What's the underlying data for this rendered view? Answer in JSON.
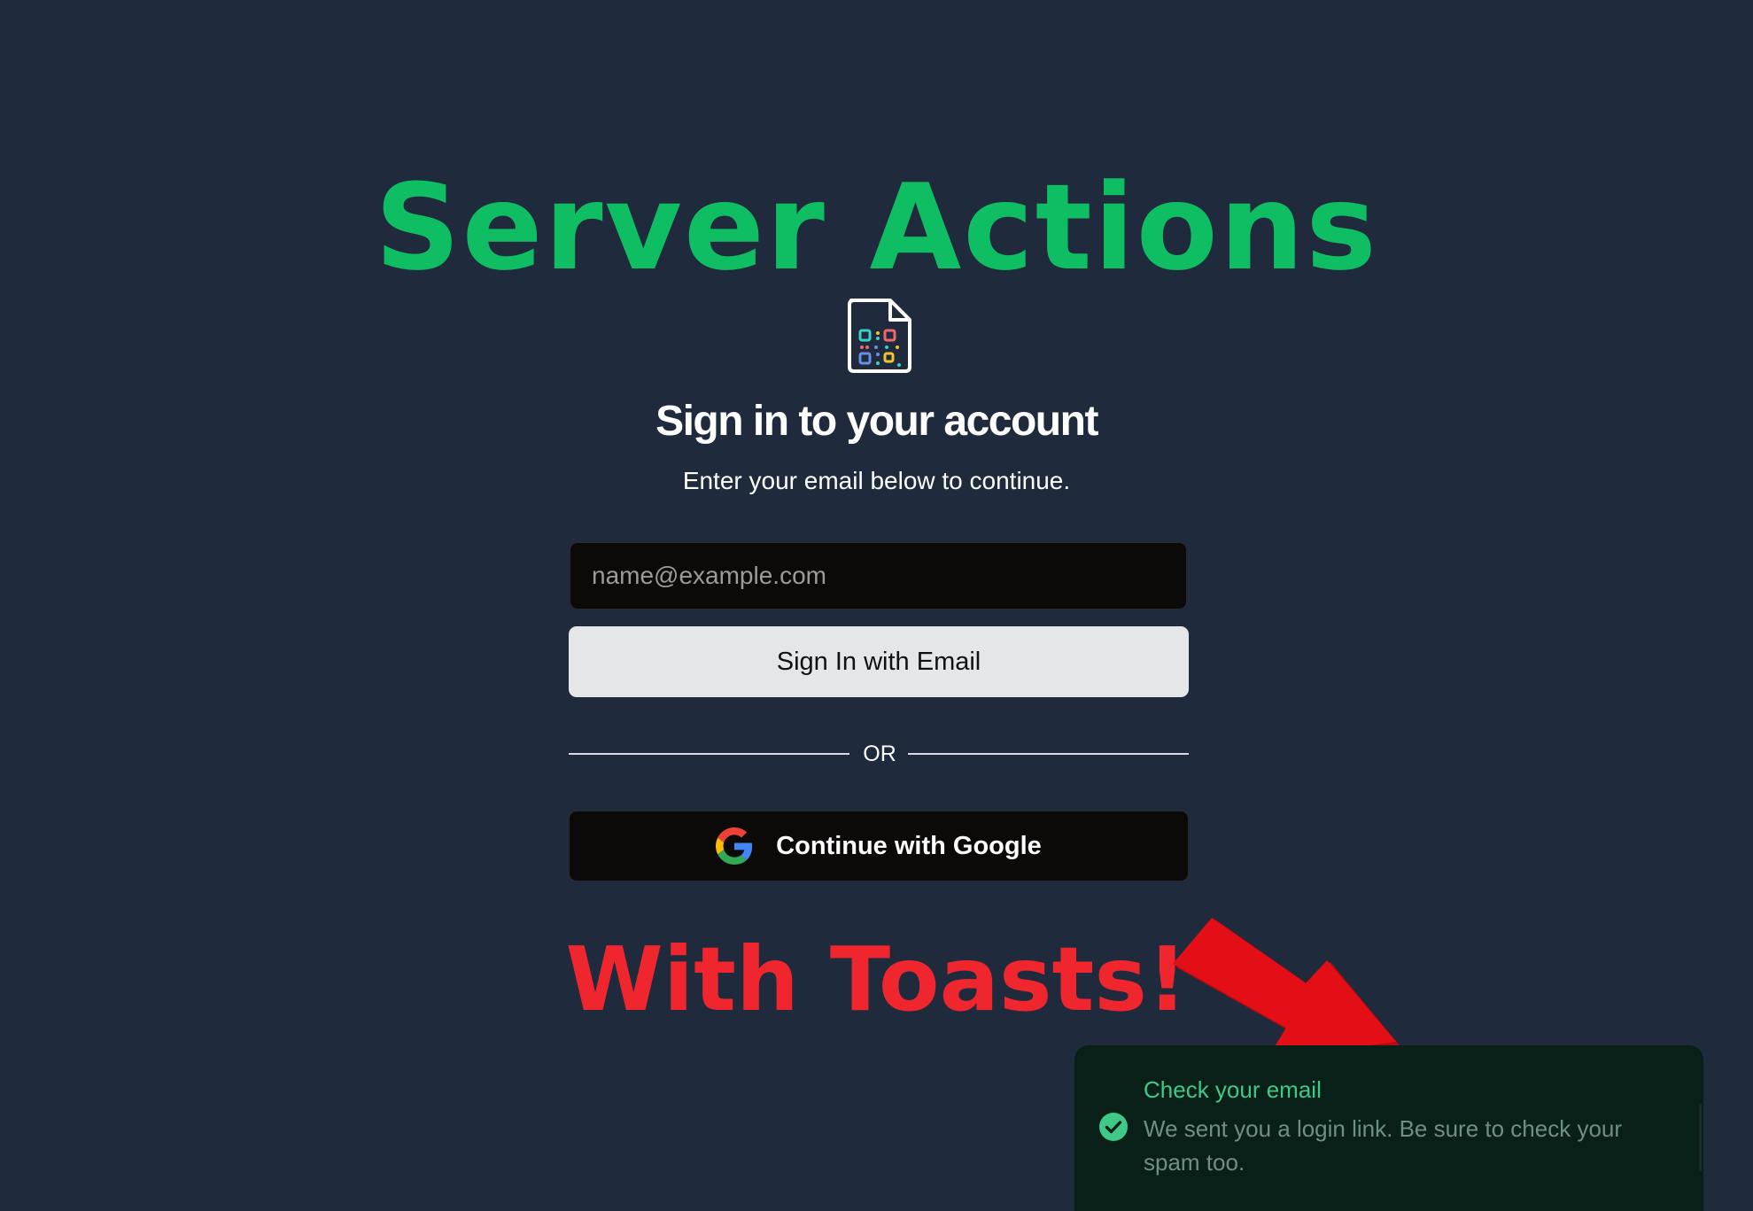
{
  "headline": "Server Actions",
  "title": "Sign in to your account",
  "subtitle": "Enter your email below to continue.",
  "email": {
    "placeholder": "name@example.com",
    "value": ""
  },
  "primary_button": "Sign In with Email",
  "divider": "OR",
  "google_button": "Continue with Google",
  "annotation": "With Toasts!",
  "toast": {
    "title": "Check your email",
    "body": "We sent you a login link. Be sure to check your spam too."
  },
  "icons": {
    "logo": "qr-code-document-icon",
    "google": "google-g-icon",
    "arrow": "red-arrow-icon",
    "toast": "check-circle-icon"
  },
  "colors": {
    "background": "#1f2a3d",
    "headline": "#0fbd62",
    "annotation": "#f0262e",
    "toast_bg": "#092019",
    "toast_title": "#3fc989",
    "toast_body": "#6f8f82"
  }
}
